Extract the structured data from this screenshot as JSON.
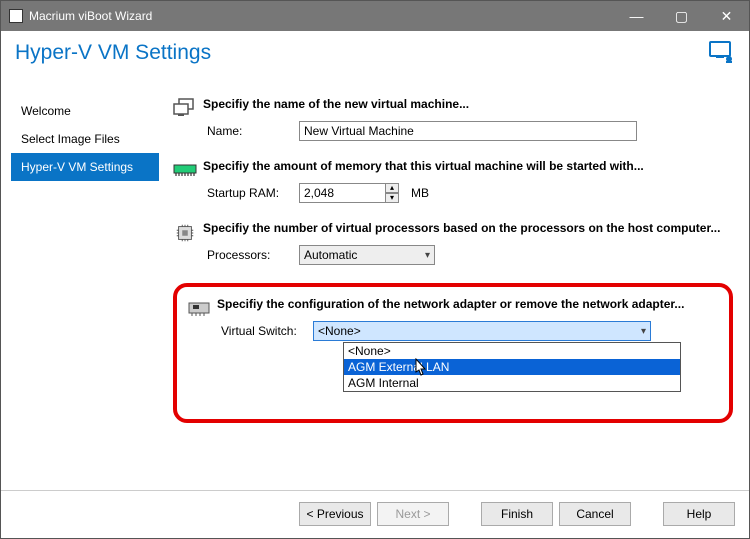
{
  "window": {
    "title": "Macrium viBoot Wizard"
  },
  "header": {
    "title": "Hyper-V VM Settings"
  },
  "sidebar": {
    "items": [
      {
        "label": "Welcome"
      },
      {
        "label": "Select Image Files"
      },
      {
        "label": "Hyper-V VM Settings"
      }
    ],
    "selected_index": 2
  },
  "sections": {
    "name": {
      "desc": "Specifiy the name of the new virtual machine...",
      "label": "Name:",
      "value": "New Virtual Machine"
    },
    "ram": {
      "desc": "Specifiy the amount of memory that this virtual machine will be started with...",
      "label": "Startup RAM:",
      "value": "2,048",
      "unit": "MB"
    },
    "cpu": {
      "desc": "Specifiy the number of virtual processors based on the processors on the host computer...",
      "label": "Processors:",
      "value": "Automatic"
    },
    "net": {
      "desc": "Specifiy the configuration of the network adapter or remove the network adapter...",
      "label": "Virtual Switch:",
      "value": "<None>",
      "options": [
        "<None>",
        "AGM External LAN",
        "AGM Internal"
      ],
      "hovered_index": 1
    }
  },
  "footer": {
    "previous": "< Previous",
    "next": "Next >",
    "finish": "Finish",
    "cancel": "Cancel",
    "help": "Help"
  }
}
